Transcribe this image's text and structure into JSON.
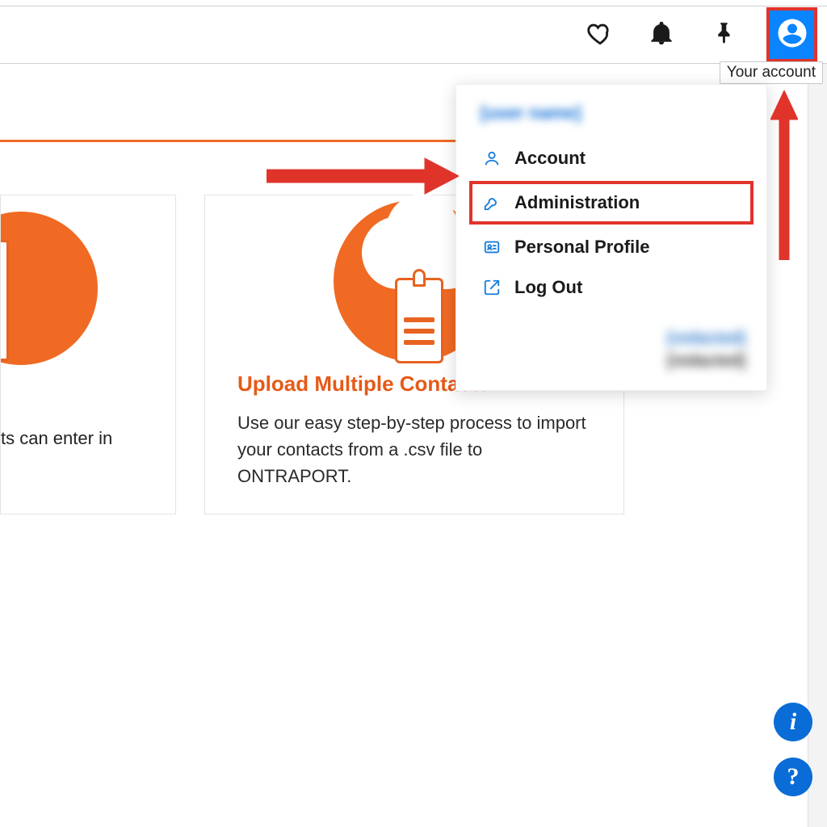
{
  "topbar": {
    "tooltip": "Your account"
  },
  "dropdown": {
    "username_blurred": "[user name]",
    "items": [
      {
        "label": "Account",
        "icon": "user-icon"
      },
      {
        "label": "Administration",
        "icon": "wrench-icon",
        "highlight": true
      },
      {
        "label": "Personal Profile",
        "icon": "id-card-icon"
      },
      {
        "label": "Log Out",
        "icon": "external-link-icon"
      }
    ],
    "footer_blurred_line1": "[redacted]",
    "footer_blurred_line2": "[redacted]"
  },
  "left_card": {
    "text_fragment": "ts can enter in"
  },
  "right_card": {
    "title": "Upload Multiple Contacts",
    "body": "Use our easy step-by-step process to import your contacts from a .csv file to ONTRAPORT."
  },
  "icons": {
    "heart": "heart-icon",
    "bell": "bell-icon",
    "pin": "pin-icon",
    "account": "account-circle-icon"
  }
}
